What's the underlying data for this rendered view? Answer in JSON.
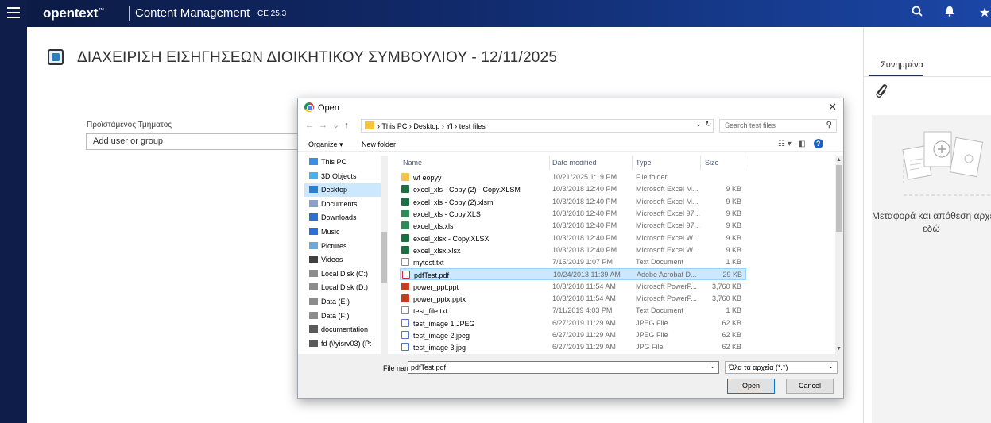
{
  "topbar": {
    "brand": "opentext",
    "brand_tm": "™",
    "product": "Content Management",
    "version": "CE 25.3"
  },
  "page": {
    "title": "ΔΙΑΧΕΙΡΙΣΗ ΕΙΣΗΓΗΣΕΩΝ ΔΙΟΙΚΗΤΙΚΟΥ ΣΥΜΒΟΥΛΙΟΥ - 12/11/2025",
    "field_label": "Προϊστάμενος Τμήματος",
    "field_placeholder": "Add user or group"
  },
  "right_panel": {
    "tab_label": "Συνημμένα",
    "drop_text_line1": "Μεταφορά και απόθεση αρχείων",
    "drop_text_line2": "εδώ"
  },
  "dialog": {
    "title": "Open",
    "close": "✕",
    "breadcrumb": "›  This PC  ›  Desktop  ›  YI  ›  test files",
    "search_placeholder": "Search test files",
    "organize_label": "Organize ▾",
    "new_folder_label": "New folder",
    "nav_items": [
      {
        "label": "This PC",
        "icon": "pc-icon",
        "color": "#3a8ee6"
      },
      {
        "label": "3D Objects",
        "icon": "cube-icon",
        "color": "#4ab0e8"
      },
      {
        "label": "Desktop",
        "icon": "desktop-icon",
        "color": "#2a7fd4"
      },
      {
        "label": "Documents",
        "icon": "documents-icon",
        "color": "#8aa2c8"
      },
      {
        "label": "Downloads",
        "icon": "download-icon",
        "color": "#2f6fd0"
      },
      {
        "label": "Music",
        "icon": "music-icon",
        "color": "#2d6fd8"
      },
      {
        "label": "Pictures",
        "icon": "pictures-icon",
        "color": "#6fa8dc"
      },
      {
        "label": "Videos",
        "icon": "videos-icon",
        "color": "#404040"
      },
      {
        "label": "Local Disk (C:)",
        "icon": "drive-icon",
        "color": "#8c8c8c"
      },
      {
        "label": "Local Disk (D:)",
        "icon": "drive-icon",
        "color": "#8c8c8c"
      },
      {
        "label": "Data (E:)",
        "icon": "drive-icon",
        "color": "#8c8c8c"
      },
      {
        "label": "Data (F:)",
        "icon": "drive-icon",
        "color": "#8c8c8c"
      },
      {
        "label": "documentation",
        "icon": "network-drive-icon",
        "color": "#5a5a5a"
      },
      {
        "label": "fd (\\\\yisrv03) (P:",
        "icon": "network-drive-icon",
        "color": "#5a5a5a"
      }
    ],
    "columns": {
      "name": "Name",
      "date": "Date modified",
      "type": "Type",
      "size": "Size"
    },
    "files": [
      {
        "name": "wf eopyy",
        "date": "10/21/2025 1:19 PM",
        "type": "File folder",
        "size": "",
        "icon": "folder"
      },
      {
        "name": "excel_xls - Copy (2) - Copy.XLSM",
        "date": "10/3/2018 12:40 PM",
        "type": "Microsoft Excel M...",
        "size": "9 KB",
        "icon": "xlsm"
      },
      {
        "name": "excel_xls - Copy (2).xlsm",
        "date": "10/3/2018 12:40 PM",
        "type": "Microsoft Excel M...",
        "size": "9 KB",
        "icon": "xlsm"
      },
      {
        "name": "excel_xls - Copy.XLS",
        "date": "10/3/2018 12:40 PM",
        "type": "Microsoft Excel 97...",
        "size": "9 KB",
        "icon": "xls"
      },
      {
        "name": "excel_xls.xls",
        "date": "10/3/2018 12:40 PM",
        "type": "Microsoft Excel 97...",
        "size": "9 KB",
        "icon": "xls"
      },
      {
        "name": "excel_xlsx - Copy.XLSX",
        "date": "10/3/2018 12:40 PM",
        "type": "Microsoft Excel W...",
        "size": "9 KB",
        "icon": "xlsm"
      },
      {
        "name": "excel_xlsx.xlsx",
        "date": "10/3/2018 12:40 PM",
        "type": "Microsoft Excel W...",
        "size": "9 KB",
        "icon": "xlsm"
      },
      {
        "name": "mytest.txt",
        "date": "7/15/2019 1:07 PM",
        "type": "Text Document",
        "size": "1 KB",
        "icon": "txt"
      },
      {
        "name": "pdfTest.pdf",
        "date": "10/24/2018 11:39 AM",
        "type": "Adobe Acrobat D...",
        "size": "29 KB",
        "icon": "pdf",
        "selected": true
      },
      {
        "name": "power_ppt.ppt",
        "date": "10/3/2018 11:54 AM",
        "type": "Microsoft PowerP...",
        "size": "3,760 KB",
        "icon": "ppt"
      },
      {
        "name": "power_pptx.pptx",
        "date": "10/3/2018 11:54 AM",
        "type": "Microsoft PowerP...",
        "size": "3,760 KB",
        "icon": "ppt"
      },
      {
        "name": "test_file.txt",
        "date": "7/11/2019 4:03 PM",
        "type": "Text Document",
        "size": "1 KB",
        "icon": "txt"
      },
      {
        "name": "test_image 1.JPEG",
        "date": "6/27/2019 11:29 AM",
        "type": "JPEG File",
        "size": "62 KB",
        "icon": "img"
      },
      {
        "name": "test_image 2.jpeg",
        "date": "6/27/2019 11:29 AM",
        "type": "JPEG File",
        "size": "62 KB",
        "icon": "img"
      },
      {
        "name": "test_image 3.jpg",
        "date": "6/27/2019 11:29 AM",
        "type": "JPG File",
        "size": "62 KB",
        "icon": "img"
      }
    ],
    "file_name_label": "File name:",
    "file_name_value": "pdfTest.pdf",
    "filter_value": "Όλα τα αρχεία (*.*)",
    "open_label": "Open",
    "cancel_label": "Cancel"
  }
}
